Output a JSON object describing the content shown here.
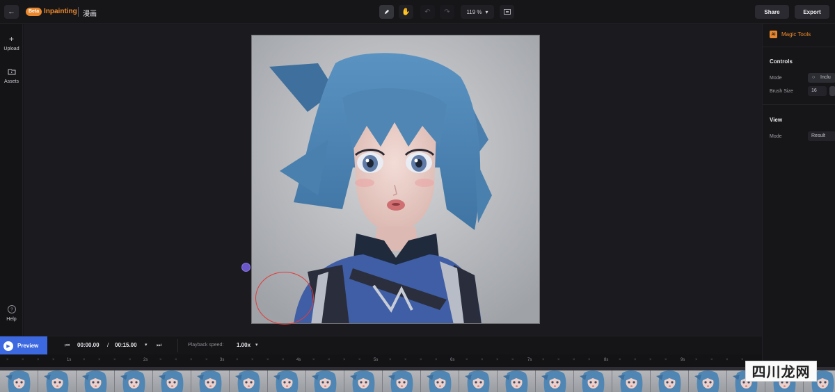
{
  "header": {
    "back_icon": "arrow-left-icon",
    "badge": "Beta",
    "app_title": "Inpainting",
    "project_name": "漫画",
    "tools": [
      {
        "name": "brush-tool",
        "icon": "pencil-icon",
        "active": true
      },
      {
        "name": "hand-tool",
        "icon": "hand-icon",
        "active": false
      },
      {
        "name": "undo",
        "icon": "undo-icon",
        "active": false
      },
      {
        "name": "redo",
        "icon": "redo-icon",
        "active": false
      }
    ],
    "zoom": "119 %",
    "share_label": "Share",
    "export_label": "Export"
  },
  "sidebar": {
    "items": [
      {
        "label": "Upload",
        "icon": "plus-icon"
      },
      {
        "label": "Assets",
        "icon": "folder-icon"
      },
      {
        "label": "Help",
        "icon": "help-icon"
      }
    ]
  },
  "right_panel": {
    "header": "Magic Tools",
    "header_icon_text": "AI",
    "controls": {
      "title": "Controls",
      "mode_label": "Mode",
      "mode_value": "Inclu",
      "brush_size_label": "Brush Size",
      "brush_size_value": "16"
    },
    "view": {
      "title": "View",
      "mode_label": "Mode",
      "mode_value": "Result"
    }
  },
  "transport": {
    "preview_label": "Preview",
    "current_time": "00:00.00",
    "separator": "/",
    "total_time": "00:15.00",
    "speed_label": "Playback speed:",
    "speed_value": "1.00x"
  },
  "timeline": {
    "tick_labels": [
      "1s",
      "2s",
      "3s",
      "4s",
      "5s",
      "6s",
      "7s",
      "8s",
      "9s"
    ]
  },
  "watermark": "四川龙网",
  "colors": {
    "accent_orange": "#f08a2a",
    "preview_blue": "#3c69e0",
    "brush_red": "#e23c3c",
    "handle_purple": "#6c57c9",
    "hair_blue": "#4f86b3"
  }
}
